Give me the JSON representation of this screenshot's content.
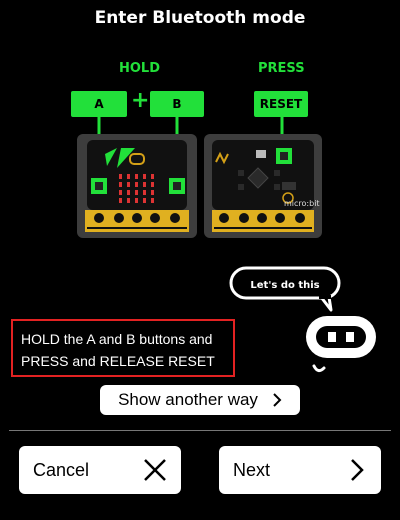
{
  "header": {
    "title": "Enter Bluetooth mode"
  },
  "diagram": {
    "hold_label": "HOLD",
    "press_label": "PRESS",
    "keys": {
      "a": "A",
      "b": "B",
      "reset": "RESET"
    },
    "plus": "+",
    "accent_color": "#22e03a",
    "board_back_brand": "micro:bit"
  },
  "instruction": {
    "line1": "HOLD the A and B buttons and",
    "line2": "PRESS and RELEASE RESET",
    "highlight_color": "#e32222"
  },
  "bubble": {
    "text": "Let's do this"
  },
  "show_another": {
    "label": "Show another way",
    "icon": "chevron-right-icon"
  },
  "footer": {
    "cancel": {
      "label": "Cancel",
      "icon": "close-icon"
    },
    "next": {
      "label": "Next",
      "icon": "chevron-right-icon"
    }
  }
}
